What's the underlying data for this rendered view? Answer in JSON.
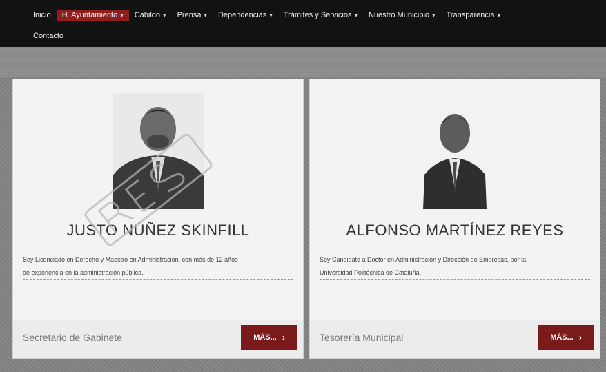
{
  "nav": {
    "items": [
      {
        "label": "Inicio",
        "caret": ""
      },
      {
        "label": "H. Ayuntamiento",
        "caret": "▾"
      },
      {
        "label": "Cabildo",
        "caret": "▾"
      },
      {
        "label": "Prensa",
        "caret": "▾"
      },
      {
        "label": "Dependencias",
        "caret": "▾"
      },
      {
        "label": "Trámites y Servicios",
        "caret": "▾"
      },
      {
        "label": "Nuestro Municipio",
        "caret": "▾"
      },
      {
        "label": "Transparencia",
        "caret": "▾"
      }
    ],
    "row2": [
      {
        "label": "Contacto"
      }
    ],
    "active_index": 1
  },
  "cards": [
    {
      "name": "JUSTO NÚÑEZ SKINFILL",
      "bio_lines": [
        "Soy Licenciado en Derecho y Maestro en Administración, con más de 12 años",
        "de experiencia en la administración pública."
      ],
      "role": "Secretario de Gabinete",
      "more_label": "MÁS...",
      "more_icon": "chevron-right-icon"
    },
    {
      "name": "ALFONSO MARTÍNEZ REYES",
      "bio_lines": [
        "Soy Candidato a Doctor en Administración y Dirección de Empresas, por la",
        "Universidad Politécnica de Cataluña."
      ],
      "role": "Tesorería Municipal",
      "more_label": "MÁS...",
      "more_icon": "chevron-right-icon"
    }
  ],
  "colors": {
    "nav_bg": "#121212",
    "active_bg": "#8d1f1f",
    "button_bg": "#7a1a1a"
  }
}
